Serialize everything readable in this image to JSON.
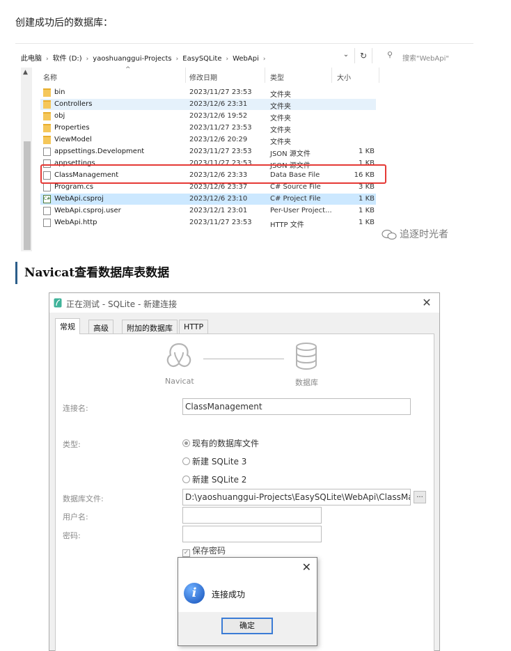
{
  "intro_text": "创建成功后的数据库：",
  "explorer": {
    "breadcrumbs": [
      "此电脑",
      "软件 (D:)",
      "yaoshuanggui-Projects",
      "EasySQLite",
      "WebApi"
    ],
    "search_placeholder": "搜索\"WebApi\"",
    "columns": {
      "name": "名称",
      "date": "修改日期",
      "type": "类型",
      "size": "大小"
    },
    "rows": [
      {
        "name": "bin",
        "date": "2023/11/27 23:53",
        "type": "文件夹",
        "size": "",
        "icon": "folder-icon"
      },
      {
        "name": "Controllers",
        "date": "2023/12/6 23:31",
        "type": "文件夹",
        "size": "",
        "icon": "folder-icon"
      },
      {
        "name": "obj",
        "date": "2023/12/6 19:52",
        "type": "文件夹",
        "size": "",
        "icon": "folder-icon"
      },
      {
        "name": "Properties",
        "date": "2023/11/27 23:53",
        "type": "文件夹",
        "size": "",
        "icon": "folder-icon"
      },
      {
        "name": "ViewModel",
        "date": "2023/12/6 20:29",
        "type": "文件夹",
        "size": "",
        "icon": "folder-icon"
      },
      {
        "name": "appsettings.Development",
        "date": "2023/11/27 23:53",
        "type": "JSON 源文件",
        "size": "1 KB",
        "icon": "json-file-icon"
      },
      {
        "name": "appsettings",
        "date": "2023/11/27 23:53",
        "type": "JSON 源文件",
        "size": "1 KB",
        "icon": "json-file-icon"
      },
      {
        "name": "ClassManagement",
        "date": "2023/12/6 23:33",
        "type": "Data Base File",
        "size": "16 KB",
        "icon": "database-file-icon"
      },
      {
        "name": "Program.cs",
        "date": "2023/12/6 23:37",
        "type": "C# Source File",
        "size": "3 KB",
        "icon": "cs-file-icon"
      },
      {
        "name": "WebApi.csproj",
        "date": "2023/12/6 23:10",
        "type": "C# Project File",
        "size": "1 KB",
        "icon": "csproj-file-icon"
      },
      {
        "name": "WebApi.csproj.user",
        "date": "2023/12/1 23:01",
        "type": "Per-User Project...",
        "size": "1 KB",
        "icon": "user-file-icon"
      },
      {
        "name": "WebApi.http",
        "date": "2023/11/27 23:53",
        "type": "HTTP 文件",
        "size": "1 KB",
        "icon": "http-file-icon"
      }
    ]
  },
  "watermark": "追逐时光者",
  "section_heading": "Navicat查看数据库表数据",
  "dialog": {
    "title": "正在测试 - SQLite - 新建连接",
    "tabs": [
      "常规",
      "高级",
      "附加的数据库",
      "HTTP"
    ],
    "navicat_label": "Navicat",
    "db_label": "数据库",
    "conn_name_label": "连接名:",
    "conn_name_value": "ClassManagement",
    "type_label": "类型:",
    "type_options": [
      "现有的数据库文件",
      "新建 SQLite 3",
      "新建 SQLite 2"
    ],
    "db_file_label": "数据库文件:",
    "db_file_value": "D:\\yaoshuanggui-Projects\\EasySQLite\\WebApi\\ClassMa",
    "browse_label": "...",
    "username_label": "用户名:",
    "password_label": "密码:",
    "save_password_label": "保存密码"
  },
  "message_box": {
    "text": "连接成功",
    "ok_label": "确定"
  }
}
